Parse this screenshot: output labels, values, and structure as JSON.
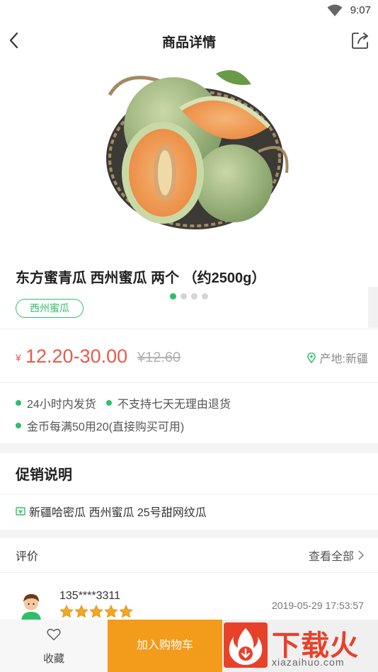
{
  "status": {
    "time": "9:07"
  },
  "nav": {
    "title": "商品详情"
  },
  "carousel": {
    "total": 4,
    "active_index": 1
  },
  "product": {
    "title": "东方蜜青瓜  西州蜜瓜 两个 （约2500g）",
    "tag": "西州蜜瓜",
    "price_symbol": "¥",
    "price": "12.20-30.00",
    "original_price": "¥12.60",
    "origin": "产地:新疆"
  },
  "services": {
    "items": [
      "24小时内发货",
      "不支持七天无理由退货",
      "金币每满50用20(直接购买可用)"
    ]
  },
  "promotion": {
    "heading": "促销说明",
    "item": "新疆哈密瓜    西州蜜瓜 25号甜网纹瓜"
  },
  "reviews": {
    "heading": "评价",
    "view_all": "查看全部",
    "items": [
      {
        "user": "135****3311",
        "rating": 5,
        "date": "2019-05-29 17:53:57"
      }
    ]
  },
  "bottom_bar": {
    "favorite_label": "收藏",
    "add_to_cart_label": "加入购物车"
  },
  "watermark": {
    "title": "下载火",
    "subtitle": "xiazaihuo.com"
  },
  "colors": {
    "accent_green": "#2fbf6a",
    "price_red": "#e85a4b",
    "cart_orange": "#f39b1a",
    "star_orange": "#f5a623"
  }
}
